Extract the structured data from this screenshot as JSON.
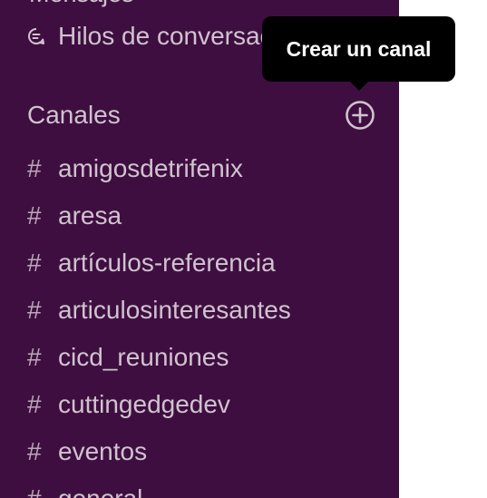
{
  "sidebar": {
    "clipped_item_label": "Mensajes",
    "threads": {
      "icon": "threads-icon",
      "label": "Hilos de conversación"
    },
    "channels_section": {
      "title": "Canales",
      "add_icon": "add-circle-icon",
      "items": [
        {
          "label": "amigosdetrifenix"
        },
        {
          "label": "aresa"
        },
        {
          "label": "artículos-referencia"
        },
        {
          "label": "articulosinteresantes"
        },
        {
          "label": "cicd_reuniones"
        },
        {
          "label": "cuttingedgedev"
        },
        {
          "label": "eventos"
        },
        {
          "label": "general"
        }
      ],
      "hash_symbol": "#"
    }
  },
  "tooltip": {
    "text": "Crear un canal"
  },
  "colors": {
    "sidebar_bg": "#3f0e40",
    "sidebar_text": "#cfc3cf",
    "tooltip_bg": "#000000",
    "tooltip_text": "#ffffff",
    "main_bg": "#ffffff"
  }
}
